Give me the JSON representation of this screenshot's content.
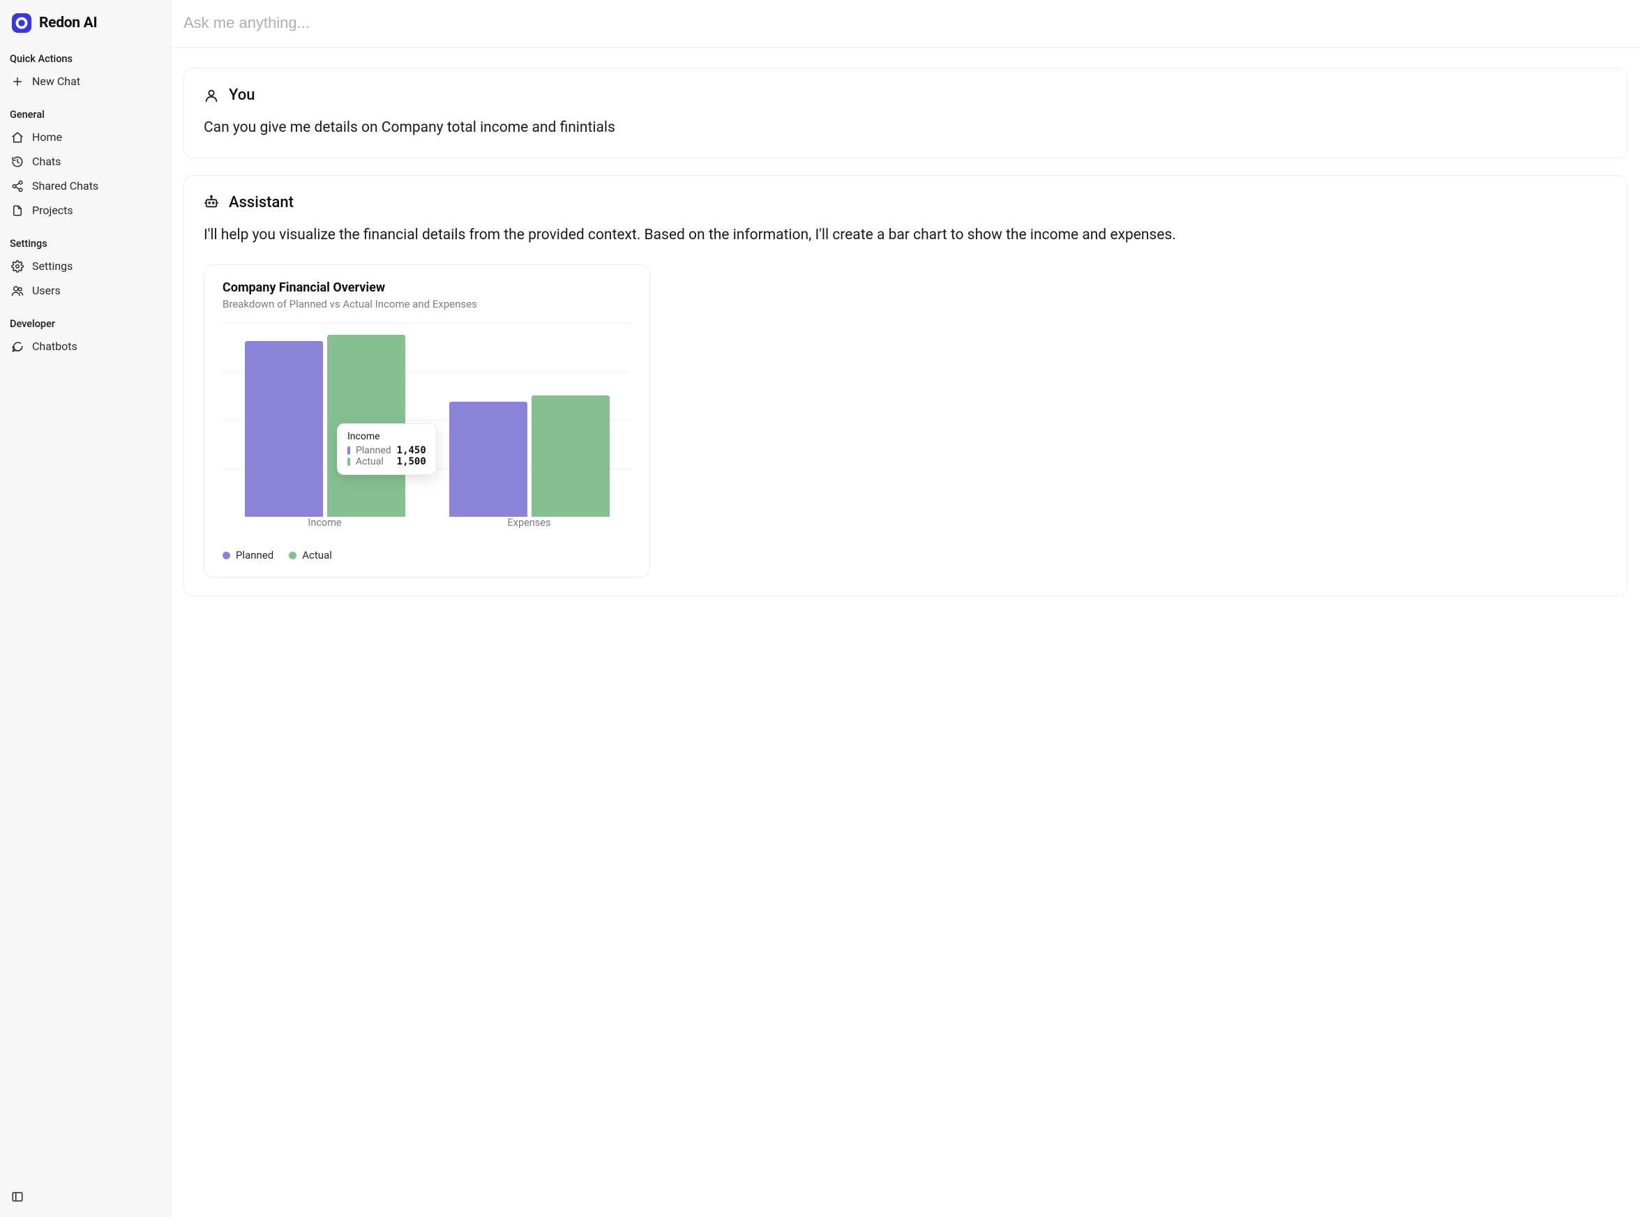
{
  "brand": {
    "name": "Redon AI"
  },
  "sidebar": {
    "quick_actions_label": "Quick Actions",
    "new_chat_label": "New Chat",
    "general_label": "General",
    "home_label": "Home",
    "chats_label": "Chats",
    "shared_chats_label": "Shared Chats",
    "projects_label": "Projects",
    "settings_section_label": "Settings",
    "settings_label": "Settings",
    "users_label": "Users",
    "developer_label": "Developer",
    "chatbots_label": "Chatbots"
  },
  "ask": {
    "placeholder": "Ask me anything..."
  },
  "thread": {
    "user_label": "You",
    "user_text": "Can you give me details on Company total income and finintials",
    "assistant_label": "Assistant",
    "assistant_text": "I'll help you visualize the financial details from the provided context. Based on the information, I'll create a bar chart to show the income and expenses."
  },
  "chart_data": {
    "type": "bar",
    "title": "Company Financial Overview",
    "subtitle": "Breakdown of Planned vs Actual Income and Expenses",
    "categories": [
      "Income",
      "Expenses"
    ],
    "series": [
      {
        "name": "Planned",
        "color": "#8b83d7",
        "values": [
          1450,
          950
        ]
      },
      {
        "name": "Actual",
        "color": "#86c091",
        "values": [
          1500,
          1000
        ]
      }
    ],
    "ylim": [
      0,
      1600
    ],
    "xlabel": "",
    "ylabel": "",
    "grid": true,
    "legend_position": "bottom",
    "tooltip": {
      "category": "Income",
      "rows": [
        {
          "series": "Planned",
          "value_text": "1,450"
        },
        {
          "series": "Actual",
          "value_text": "1,500"
        }
      ]
    }
  }
}
